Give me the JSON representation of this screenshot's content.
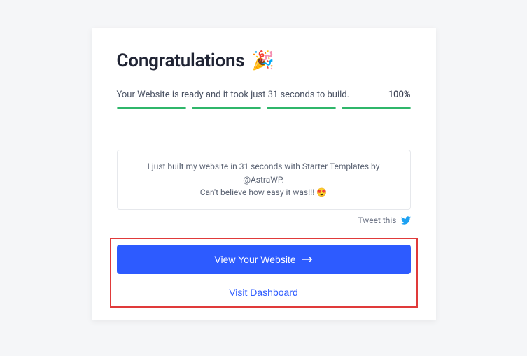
{
  "title": "Congratulations",
  "title_emoji": "🎉",
  "status_text": "Your Website is ready and it took just 31 seconds to build.",
  "percent": "100%",
  "tweet_box_line1": "I just built my website in 31 seconds with Starter Templates by @AstraWP.",
  "tweet_box_line2": "Can't believe how easy it was!!!",
  "tweet_box_emoji": "😍",
  "tweet_this_label": "Tweet this",
  "primary_button": "View Your Website",
  "secondary_button": "Visit Dashboard"
}
